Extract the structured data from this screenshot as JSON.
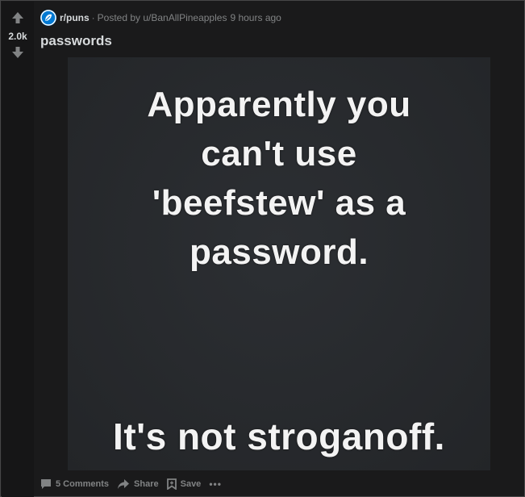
{
  "vote": {
    "count": "2.0k",
    "up_icon": "arrow-up-icon",
    "down_icon": "arrow-down-icon"
  },
  "meta": {
    "subreddit": "r/puns",
    "separator": "·",
    "posted_by": "Posted by u/BanAllPineapples",
    "time": "9 hours ago"
  },
  "post": {
    "title": "passwords"
  },
  "meme": {
    "top_lines": [
      "Apparently you",
      "can't use",
      "'beefstew' as a",
      "password."
    ],
    "bottom_line": "It's not stroganoff."
  },
  "actions": {
    "comments_label": "5 Comments",
    "share_label": "Share",
    "save_label": "Save",
    "more_label": "•••"
  },
  "colors": {
    "card_bg": "#1a1a1b",
    "vote_col_bg": "#161617",
    "text_primary": "#d7dadc",
    "text_meta": "#818384",
    "subreddit_icon": "#0079d3"
  }
}
